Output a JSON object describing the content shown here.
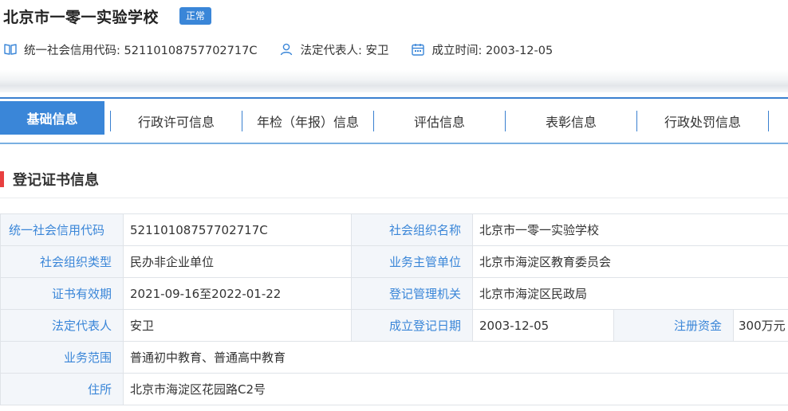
{
  "header": {
    "title": "北京市一零一实验学校",
    "status": "正常",
    "meta": [
      {
        "icon": "book-icon",
        "text": "统一社会信用代码: 52110108757702717C"
      },
      {
        "icon": "user-icon",
        "text": "法定代表人: 安卫"
      },
      {
        "icon": "calendar-icon",
        "text": "成立时间: 2003-12-05"
      }
    ]
  },
  "tabs": [
    "基础信息",
    "行政许可信息",
    "年检（年报）信息",
    "评估信息",
    "表彰信息",
    "行政处罚信息"
  ],
  "section": {
    "title": "登记证书信息"
  },
  "fields": {
    "credit_code": {
      "label": "统一社会信用代码",
      "value": "52110108757702717C"
    },
    "org_name": {
      "label": "社会组织名称",
      "value": "北京市一零一实验学校"
    },
    "org_type": {
      "label": "社会组织类型",
      "value": "民办非企业单位"
    },
    "supervisor": {
      "label": "业务主管单位",
      "value": "北京市海淀区教育委员会"
    },
    "validity": {
      "label": "证书有效期",
      "value": "2021-09-16至2022-01-22"
    },
    "registrar": {
      "label": "登记管理机关",
      "value": "北京市海淀区民政局"
    },
    "legal_rep": {
      "label": "法定代表人",
      "value": "安卫"
    },
    "reg_date": {
      "label": "成立登记日期",
      "value": "2003-12-05"
    },
    "capital": {
      "label": "注册资金",
      "value": "300万元"
    },
    "scope": {
      "label": "业务范围",
      "value": "普通初中教育、普通高中教育"
    },
    "address": {
      "label": "住所",
      "value": "北京市海淀区花园路C2号"
    }
  },
  "colors": {
    "accent": "#3a86d8",
    "section_bar": "#e83f3f",
    "label_bg": "#f3f6fa"
  }
}
